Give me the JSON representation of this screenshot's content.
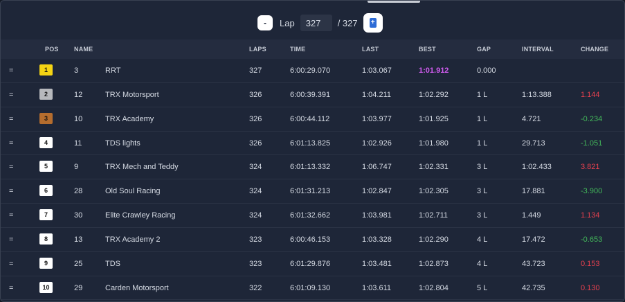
{
  "lap_control": {
    "minus_label": "-",
    "label": "Lap",
    "value": "327",
    "total": "/ 327",
    "plus_label": "+"
  },
  "columns": {
    "pos": "POS",
    "name": "NAME",
    "laps": "LAPS",
    "time": "TIME",
    "last": "LAST",
    "best": "BEST",
    "gap": "GAP",
    "interval": "INTERVAL",
    "change": "CHANGE"
  },
  "colors": {
    "gold": "#f5d414",
    "silver": "#b7b9bd",
    "bronze": "#b56d2e",
    "best_lap": "#d15cf0",
    "change_negative": "#43b85a",
    "change_positive": "#e8414f"
  },
  "rows": [
    {
      "trend": "=",
      "pos": "1",
      "number": "3",
      "name": "RRT",
      "laps": "327",
      "time": "6:00:29.070",
      "last": "1:03.067",
      "best": "1:01.912",
      "gap": "0.000",
      "interval": "",
      "change": "",
      "change_sign": ""
    },
    {
      "trend": "=",
      "pos": "2",
      "number": "12",
      "name": "TRX Motorsport",
      "laps": "326",
      "time": "6:00:39.391",
      "last": "1:04.211",
      "best": "1:02.292",
      "gap": "1 L",
      "interval": "1:13.388",
      "change": "1.144",
      "change_sign": "pos"
    },
    {
      "trend": "=",
      "pos": "3",
      "number": "10",
      "name": "TRX Academy",
      "laps": "326",
      "time": "6:00:44.112",
      "last": "1:03.977",
      "best": "1:01.925",
      "gap": "1 L",
      "interval": "4.721",
      "change": "-0.234",
      "change_sign": "neg"
    },
    {
      "trend": "=",
      "pos": "4",
      "number": "11",
      "name": "TDS lights",
      "laps": "326",
      "time": "6:01:13.825",
      "last": "1:02.926",
      "best": "1:01.980",
      "gap": "1 L",
      "interval": "29.713",
      "change": "-1.051",
      "change_sign": "neg"
    },
    {
      "trend": "=",
      "pos": "5",
      "number": "9",
      "name": "TRX Mech and Teddy",
      "laps": "324",
      "time": "6:01:13.332",
      "last": "1:06.747",
      "best": "1:02.331",
      "gap": "3 L",
      "interval": "1:02.433",
      "change": "3.821",
      "change_sign": "pos"
    },
    {
      "trend": "=",
      "pos": "6",
      "number": "28",
      "name": "Old Soul Racing",
      "laps": "324",
      "time": "6:01:31.213",
      "last": "1:02.847",
      "best": "1:02.305",
      "gap": "3 L",
      "interval": "17.881",
      "change": "-3.900",
      "change_sign": "neg"
    },
    {
      "trend": "=",
      "pos": "7",
      "number": "30",
      "name": "Elite Crawley Racing",
      "laps": "324",
      "time": "6:01:32.662",
      "last": "1:03.981",
      "best": "1:02.711",
      "gap": "3 L",
      "interval": "1.449",
      "change": "1.134",
      "change_sign": "pos"
    },
    {
      "trend": "=",
      "pos": "8",
      "number": "13",
      "name": "TRX Academy 2",
      "laps": "323",
      "time": "6:00:46.153",
      "last": "1:03.328",
      "best": "1:02.290",
      "gap": "4 L",
      "interval": "17.472",
      "change": "-0.653",
      "change_sign": "neg"
    },
    {
      "trend": "=",
      "pos": "9",
      "number": "25",
      "name": "TDS",
      "laps": "323",
      "time": "6:01:29.876",
      "last": "1:03.481",
      "best": "1:02.873",
      "gap": "4 L",
      "interval": "43.723",
      "change": "0.153",
      "change_sign": "pos"
    },
    {
      "trend": "=",
      "pos": "10",
      "number": "29",
      "name": "Carden Motorsport",
      "laps": "322",
      "time": "6:01:09.130",
      "last": "1:03.611",
      "best": "1:02.804",
      "gap": "5 L",
      "interval": "42.735",
      "change": "0.130",
      "change_sign": "pos"
    }
  ]
}
